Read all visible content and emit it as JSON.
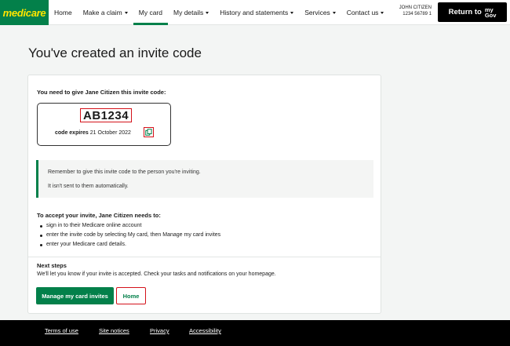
{
  "brand": {
    "name": "medicare",
    "color": "#03804a",
    "text_color": "#ffe500"
  },
  "nav": {
    "items": [
      {
        "label": "Home",
        "has_menu": false,
        "active": false
      },
      {
        "label": "Make a claim",
        "has_menu": true,
        "active": false
      },
      {
        "label": "My card",
        "has_menu": false,
        "active": true
      },
      {
        "label": "My details",
        "has_menu": true,
        "active": false
      },
      {
        "label": "History and statements",
        "has_menu": true,
        "active": false
      },
      {
        "label": "Services",
        "has_menu": true,
        "active": false
      },
      {
        "label": "Contact us",
        "has_menu": true,
        "active": false
      }
    ]
  },
  "user": {
    "name": "JOHN CITIZEN",
    "card_number": "1234 56789 1"
  },
  "mygov_button": {
    "label": "Return to",
    "logo_top": "my",
    "logo_bottom": "Gov"
  },
  "page": {
    "title": "You've created an invite code"
  },
  "invite": {
    "give_label": "You need to give Jane Citizen this invite code:",
    "code": "AB1234",
    "expires_label": "code expires",
    "expires_date": "21 October 2022",
    "copy_icon": "copy-icon"
  },
  "notice": {
    "line1": "Remember to give this invite code to the person you're inviting.",
    "line2": "It isn't sent to them automatically."
  },
  "accept": {
    "title": "To accept your invite, Jane Citizen needs to:",
    "steps": [
      "sign in to their Medicare online account",
      "enter the invite code by selecting My card, then Manage my card invites",
      "enter your Medicare card details."
    ]
  },
  "next_steps": {
    "title": "Next steps",
    "text": "We'll let you know if your invite is accepted. Check your tasks and notifications on your homepage."
  },
  "buttons": {
    "manage": "Manage my card invites",
    "home": "Home"
  },
  "footer": {
    "links": [
      "Terms of use",
      "Site notices",
      "Privacy",
      "Accessibility"
    ]
  },
  "colors": {
    "accent": "#03804a",
    "highlight": "#d4121a",
    "footer": "#000000"
  }
}
